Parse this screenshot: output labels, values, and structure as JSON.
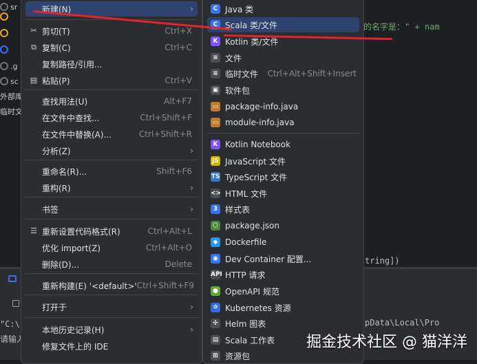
{
  "project_tree": [
    {
      "label": "sr",
      "color": "#6f737a"
    },
    {
      "label": "",
      "color": "#e8a33e"
    },
    {
      "label": "",
      "color": "#e8a33e"
    },
    {
      "label": "",
      "color": "#3574f0"
    },
    {
      "label": ".g",
      "color": "#6f737a"
    },
    {
      "label": "sc",
      "color": "#6f737a"
    },
    {
      "label": "外部库",
      "color": ""
    },
    {
      "label": "临时文",
      "color": ""
    }
  ],
  "editor": {
    "line1_str": "的名字是：\" + nam",
    "line2": "tring])"
  },
  "console": {
    "line1": "\"C:\\",
    "line2": "请输入",
    "right_text": "pData\\Local\\Pro"
  },
  "left_menu": [
    {
      "label": "新建(N)",
      "shortcut": "",
      "arrow": true,
      "icon": "",
      "selected": true
    },
    {
      "label": "剪切(T)",
      "shortcut": "Ctrl+X",
      "arrow": false,
      "icon": "scissors-icon"
    },
    {
      "label": "复制(C)",
      "shortcut": "Ctrl+C",
      "arrow": false,
      "icon": "copy-icon"
    },
    {
      "label": "复制路径/引用...",
      "shortcut": "",
      "arrow": false,
      "icon": ""
    },
    {
      "label": "粘贴(P)",
      "shortcut": "Ctrl+V",
      "arrow": false,
      "icon": "paste-icon"
    },
    {
      "label": "查找用法(U)",
      "shortcut": "Alt+F7",
      "arrow": false,
      "icon": ""
    },
    {
      "label": "在文件中查找...",
      "shortcut": "Ctrl+Shift+F",
      "arrow": false,
      "icon": ""
    },
    {
      "label": "在文件中替换(A)...",
      "shortcut": "Ctrl+Shift+R",
      "arrow": false,
      "icon": ""
    },
    {
      "label": "分析(Z)",
      "shortcut": "",
      "arrow": true,
      "icon": ""
    },
    {
      "label": "重命名(R)...",
      "shortcut": "Shift+F6",
      "arrow": false,
      "icon": ""
    },
    {
      "label": "重构(R)",
      "shortcut": "",
      "arrow": true,
      "icon": ""
    },
    {
      "label": "书签",
      "shortcut": "",
      "arrow": true,
      "icon": ""
    },
    {
      "label": "重新设置代码格式(R)",
      "shortcut": "Ctrl+Alt+L",
      "arrow": false,
      "icon": "format-icon"
    },
    {
      "label": "优化 import(Z)",
      "shortcut": "Ctrl+Alt+O",
      "arrow": false,
      "icon": ""
    },
    {
      "label": "删除(D)...",
      "shortcut": "Delete",
      "arrow": false,
      "icon": ""
    },
    {
      "label": "重新构建(E) '<default>'",
      "shortcut": "Ctrl+Shift+F9",
      "arrow": false,
      "icon": ""
    },
    {
      "label": "打开于",
      "shortcut": "",
      "arrow": true,
      "icon": ""
    },
    {
      "label": "本地历史记录(H)",
      "shortcut": "",
      "arrow": true,
      "icon": ""
    },
    {
      "label": "修复文件上的 IDE",
      "shortcut": "",
      "arrow": false,
      "icon": ""
    }
  ],
  "right_menu": [
    {
      "label": "Java 类",
      "shortcut": "",
      "icon": "java-class-icon",
      "icon_text": "C",
      "icon_color": "#3574f0"
    },
    {
      "label": "Scala 类/文件",
      "shortcut": "",
      "icon": "scala-class-icon",
      "icon_text": "C",
      "icon_color": "#3574f0",
      "selected": true
    },
    {
      "label": "Kotlin 类/文件",
      "shortcut": "",
      "icon": "kotlin-icon",
      "icon_text": "K",
      "icon_color": "#7f52ff"
    },
    {
      "label": "文件",
      "shortcut": "",
      "icon": "file-icon",
      "icon_text": "≡",
      "icon_color": "#4a4d52"
    },
    {
      "label": "临时文件",
      "shortcut": "Ctrl+Alt+Shift+Insert",
      "icon": "scratch-file-icon",
      "icon_text": "≡",
      "icon_color": "#4a4d52"
    },
    {
      "label": "软件包",
      "shortcut": "",
      "icon": "package-icon",
      "icon_text": "▣",
      "icon_color": "#4a4d52"
    },
    {
      "label": "package-info.java",
      "shortcut": "",
      "icon": "package-info-icon",
      "icon_text": "▭",
      "icon_color": "#c07a2c"
    },
    {
      "label": "module-info.java",
      "shortcut": "",
      "icon": "module-info-icon",
      "icon_text": "▭",
      "icon_color": "#c07a2c"
    },
    {
      "label": "Kotlin Notebook",
      "shortcut": "",
      "icon": "kotlin-notebook-icon",
      "icon_text": "K",
      "icon_color": "#7f52ff"
    },
    {
      "label": "JavaScript 文件",
      "shortcut": "",
      "icon": "javascript-icon",
      "icon_text": "JS",
      "icon_color": "#d6b400"
    },
    {
      "label": "TypeScript 文件",
      "shortcut": "",
      "icon": "typescript-icon",
      "icon_text": "TS",
      "icon_color": "#3178c6"
    },
    {
      "label": "HTML 文件",
      "shortcut": "",
      "icon": "html-icon",
      "icon_text": "<>",
      "icon_color": "#4a4d52"
    },
    {
      "label": "样式表",
      "shortcut": "",
      "icon": "stylesheet-icon",
      "icon_text": "3",
      "icon_color": "#3574f0"
    },
    {
      "label": "package.json",
      "shortcut": "",
      "icon": "package-json-icon",
      "icon_text": "⬡",
      "icon_color": "#4c8b3b"
    },
    {
      "label": "Dockerfile",
      "shortcut": "",
      "icon": "docker-icon",
      "icon_text": "◆",
      "icon_color": "#2496ed"
    },
    {
      "label": "Dev Container 配置...",
      "shortcut": "",
      "icon": "dev-container-icon",
      "icon_text": "◉",
      "icon_color": "#3574f0"
    },
    {
      "label": "HTTP 请求",
      "shortcut": "",
      "icon": "http-request-icon",
      "icon_text": "API",
      "icon_color": "#4a4d52"
    },
    {
      "label": "OpenAPI 规范",
      "shortcut": "",
      "icon": "openapi-icon",
      "icon_text": "●",
      "icon_color": "#5fa83a"
    },
    {
      "label": "Kubernetes 资源",
      "shortcut": "",
      "icon": "kubernetes-icon",
      "icon_text": "✲",
      "icon_color": "#326ce5"
    },
    {
      "label": "Helm 图表",
      "shortcut": "",
      "icon": "helm-icon",
      "icon_text": "✣",
      "icon_color": "#4a4d52"
    },
    {
      "label": "Scala 工作表",
      "shortcut": "",
      "icon": "scala-worksheet-icon",
      "icon_text": "▤",
      "icon_color": "#4a4d52"
    },
    {
      "label": "资源包",
      "shortcut": "",
      "icon": "resource-bundle-icon",
      "icon_text": "⊞",
      "icon_color": "#4a4d52"
    }
  ],
  "watermark": "掘金技术社区 @ 猫洋洋",
  "colors": {
    "selection": "#2e436e",
    "annotation": "#e0262a",
    "menu_bg": "#2b2d30"
  }
}
